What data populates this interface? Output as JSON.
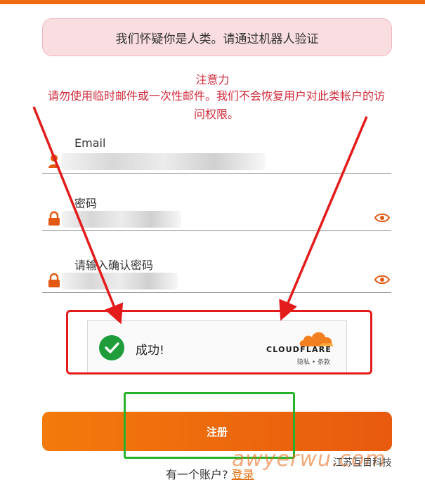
{
  "alert": {
    "text": "我们怀疑你是人类。请通过机器人验证"
  },
  "notice": {
    "title": "注意力",
    "body": "请勿使用临时邮件或一次性邮件。我们不会恢复用户对此类帐户的访问权限。"
  },
  "form": {
    "email": {
      "label": "Email",
      "value": "",
      "icon": "user-icon"
    },
    "password": {
      "label": "密码",
      "value": "",
      "icon": "lock-icon",
      "toggle_icon": "eye-icon"
    },
    "confirm_password": {
      "label": "请输入确认密码",
      "value": "",
      "icon": "lock-icon",
      "toggle_icon": "eye-icon"
    }
  },
  "captcha": {
    "status": "成功!",
    "provider": "CLOUDFLARE",
    "privacy_link": "隐私",
    "separator": "•",
    "terms_link": "条款",
    "status_icon": "check-icon"
  },
  "register_button": {
    "label": "注册"
  },
  "login_prompt": {
    "text": "有一个账户?",
    "link": "登录"
  },
  "watermark": {
    "text": "awyerwu.com",
    "brand": "江苏互目科技"
  },
  "colors": {
    "accent": "#ee6c0f",
    "alert_bg": "#f9dde0",
    "notice_text": "#d02c3c",
    "success": "#1f9d3a",
    "annotation_red": "#e31b1b",
    "annotation_green": "#28b22a"
  }
}
